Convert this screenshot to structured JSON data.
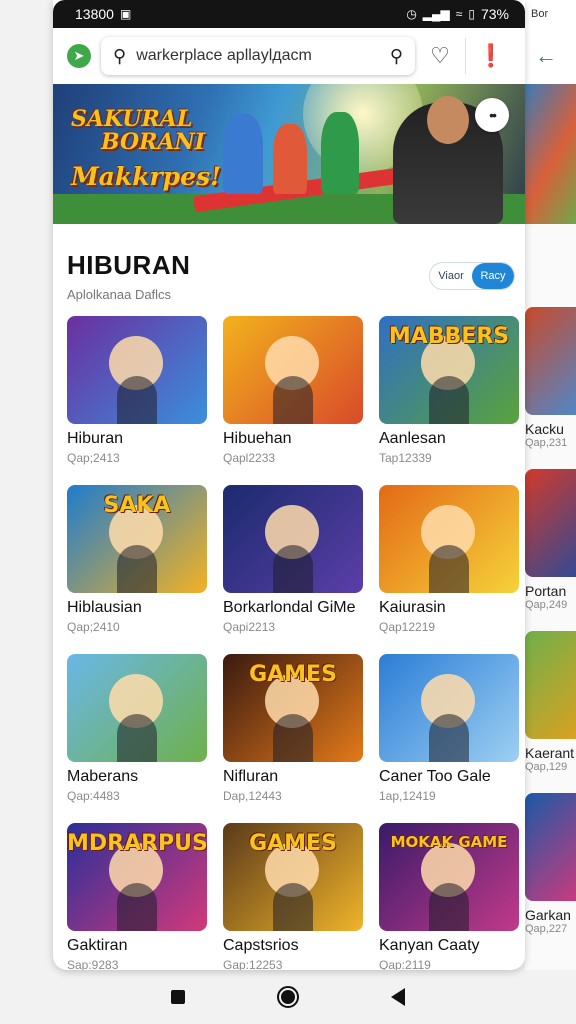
{
  "status_bar": {
    "time": "13800",
    "battery": "73%"
  },
  "peek": {
    "status_text": "Bor",
    "tiles": [
      {
        "title": "Kacku",
        "sub": "Qap,231"
      },
      {
        "title": "Portan",
        "sub": "Qap,249"
      },
      {
        "title": "Kaerant",
        "sub": "Qap,129"
      },
      {
        "title": "Garkan",
        "sub": "Qap,227"
      }
    ]
  },
  "search": {
    "value": "warkerplace apllaylдacm",
    "placeholder": "warkerplace apllaylдacm"
  },
  "banner": {
    "title_line1": "SAKURAL",
    "title_line2": "BORANI",
    "title_line3": "Makkrpes!"
  },
  "section": {
    "title": "HIBURAN",
    "subtitle": "Aplolkanaa Daflcs",
    "toggle_left": "Viaor",
    "toggle_right": "Racy"
  },
  "apps": [
    {
      "name": "Hiburan",
      "meta": "Qap;2413",
      "art": "",
      "c1": "#6b2fa0",
      "c2": "#3b8fdc"
    },
    {
      "name": "Hibuehan",
      "meta": "Qapl2233",
      "art": "",
      "c1": "#f2b21d",
      "c2": "#d94a2a"
    },
    {
      "name": "Aanlesan",
      "meta": "Tap12339",
      "art": "MABBERS",
      "c1": "#2f6fc4",
      "c2": "#5aa33a"
    },
    {
      "name": "Hiblausian",
      "meta": "Qap;2410",
      "art": "SAKA",
      "c1": "#1e7ccf",
      "c2": "#f4b223"
    },
    {
      "name": "Borkarlondal GiMe",
      "meta": "Qapi2213",
      "art": "",
      "c1": "#1b2b6e",
      "c2": "#5b3ea8"
    },
    {
      "name": "Kaiurasin",
      "meta": "Qap12219",
      "art": "",
      "c1": "#e36a16",
      "c2": "#f6d23a"
    },
    {
      "name": "Maberans",
      "meta": "Qap:4483",
      "art": "",
      "c1": "#69b7e8",
      "c2": "#6fb04a"
    },
    {
      "name": "Nifluran",
      "meta": "Dap,12443",
      "art": "GAMES",
      "c1": "#3a1a10",
      "c2": "#e47a1a"
    },
    {
      "name": "Caner Too Gale",
      "meta": "1ap,12419",
      "art": "",
      "c1": "#2b7dd6",
      "c2": "#9dd0f2"
    },
    {
      "name": "Gaktiran",
      "meta": "Sap:9283",
      "art": "MDRARPUS",
      "c1": "#2a2f9a",
      "c2": "#d2397a"
    },
    {
      "name": "Capstsrios",
      "meta": "Gap:12253",
      "art": "GAMES",
      "c1": "#5a3a1a",
      "c2": "#f0b42a"
    },
    {
      "name": "Kanyan Caaty",
      "meta": "Qap:2119",
      "art": "MOKAK GAME",
      "c1": "#3a1a6a",
      "c2": "#c23a8a"
    }
  ]
}
